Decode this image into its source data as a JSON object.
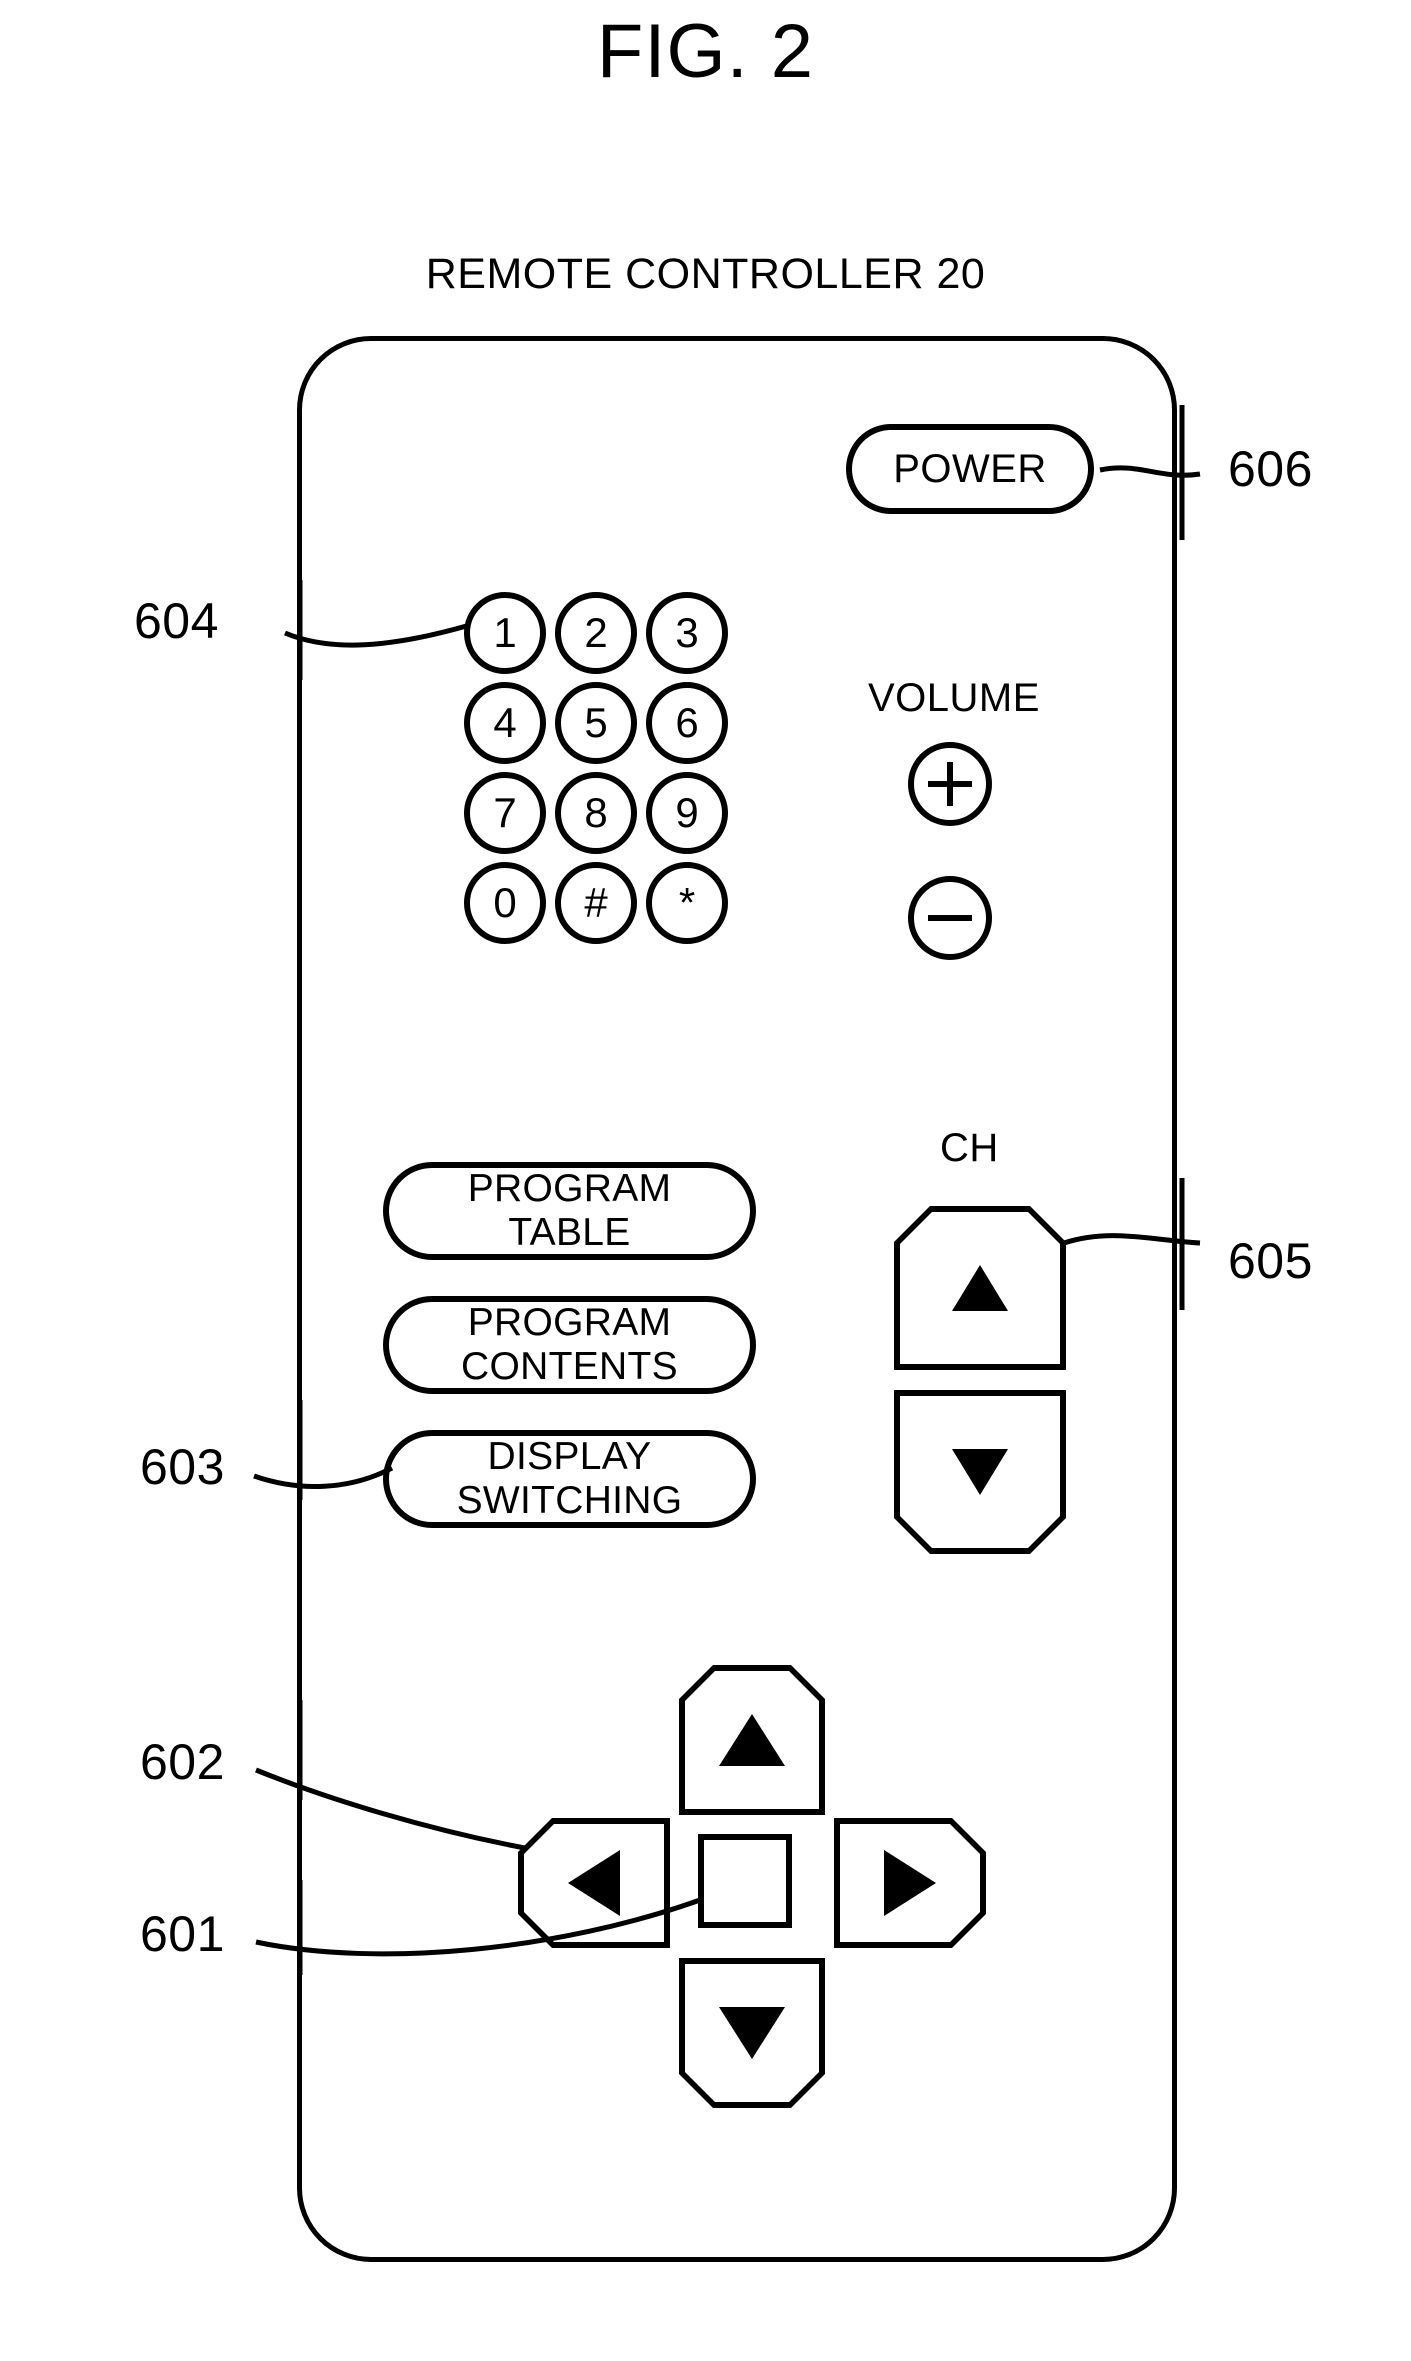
{
  "figure": {
    "title": "FIG. 2",
    "subtitle": "REMOTE CONTROLLER 20"
  },
  "remote": {
    "power": {
      "label": "POWER",
      "ref": "606"
    },
    "keypad": {
      "ref": "604",
      "keys": [
        [
          "1",
          "2",
          "3"
        ],
        [
          "4",
          "5",
          "6"
        ],
        [
          "7",
          "8",
          "9"
        ],
        [
          "0",
          "#",
          "*"
        ]
      ]
    },
    "volume": {
      "label": "VOLUME",
      "plus": "+",
      "minus": "−"
    },
    "channel": {
      "label": "CH",
      "ref": "605",
      "up_icon": "triangle-up-icon",
      "down_icon": "triangle-down-icon"
    },
    "function_buttons": {
      "ref": "603",
      "items": [
        {
          "line1": "PROGRAM",
          "line2": "TABLE"
        },
        {
          "line1": "PROGRAM",
          "line2": "CONTENTS"
        },
        {
          "line1": "DISPLAY",
          "line2": "SWITCHING"
        }
      ]
    },
    "dpad": {
      "ref_arrows": "602",
      "ref_center": "601",
      "up_icon": "triangle-up-icon",
      "down_icon": "triangle-down-icon",
      "left_icon": "triangle-left-icon",
      "right_icon": "triangle-right-icon",
      "center_icon": "square-enter-icon"
    }
  },
  "colors": {
    "ink": "#000000",
    "paper": "#ffffff"
  }
}
